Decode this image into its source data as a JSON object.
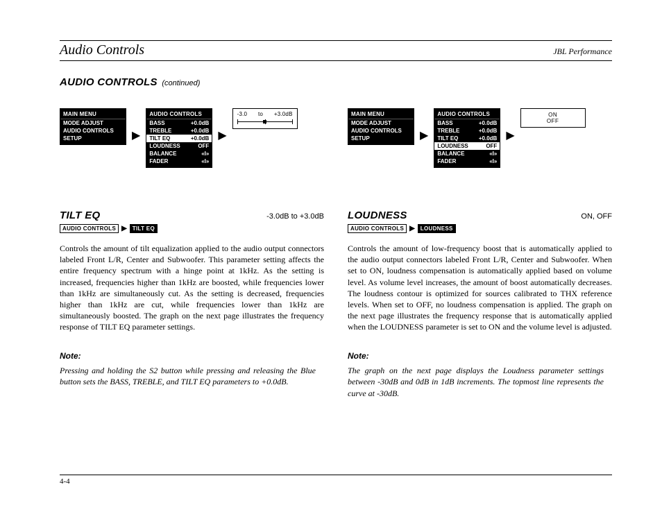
{
  "header": {
    "left": "Audio Controls",
    "right": "JBL Performance"
  },
  "section": {
    "title": "AUDIO CONTROLS",
    "cont": "(continued)"
  },
  "menuA": {
    "title": "MAIN MENU",
    "rows": [
      {
        "l": "MODE ADJUST",
        "r": ""
      },
      {
        "l": "AUDIO CONTROLS",
        "r": ""
      },
      {
        "l": "SETUP",
        "r": ""
      }
    ]
  },
  "menuB": {
    "title": "AUDIO CONTROLS",
    "rows": [
      {
        "l": "BASS",
        "r": "+0.0dB"
      },
      {
        "l": "TREBLE",
        "r": "+0.0dB"
      },
      {
        "l": "TILT EQ",
        "r": "+0.0dB",
        "sel": true
      },
      {
        "l": "LOUDNESS",
        "r": "OFF"
      },
      {
        "l": "BALANCE",
        "r": "«I»"
      },
      {
        "l": "FADER",
        "r": "«I»"
      }
    ]
  },
  "slider": {
    "min": "-3.0",
    "mid": "to",
    "max": "+3.0dB"
  },
  "menuC": {
    "title": "MAIN MENU",
    "rows": [
      {
        "l": "MODE ADJUST",
        "r": ""
      },
      {
        "l": "AUDIO CONTROLS",
        "r": ""
      },
      {
        "l": "SETUP",
        "r": ""
      }
    ]
  },
  "menuD": {
    "title": "AUDIO CONTROLS",
    "rows": [
      {
        "l": "BASS",
        "r": "+0.0dB"
      },
      {
        "l": "TREBLE",
        "r": "+0.0dB"
      },
      {
        "l": "TILT EQ",
        "r": "+0.0dB"
      },
      {
        "l": "LOUDNESS",
        "r": "OFF",
        "sel": true
      },
      {
        "l": "BALANCE",
        "r": "«I»"
      },
      {
        "l": "FADER",
        "r": "«I»"
      }
    ]
  },
  "options": {
    "on": "ON",
    "off": "OFF"
  },
  "left": {
    "title": "TILT EQ",
    "range": "-3.0dB to +3.0dB",
    "crumb1": "AUDIO CONTROLS",
    "crumb2": "TILT EQ",
    "body": "Controls the amount of tilt equalization applied to the audio output connectors labeled Front L/R, Center and Subwoofer. This parameter setting affects the entire frequency spectrum with a hinge point at 1kHz. As the setting is increased, frequencies higher than 1kHz are boosted, while frequencies lower than 1kHz are simultaneously cut. As the setting is decreased, frequencies higher than 1kHz are cut, while frequencies lower than 1kHz are simultaneously boosted. The graph on the next page illustrates the frequency response of TILT EQ parameter settings.",
    "noteH": "Note:",
    "noteBody": "Pressing and holding the S2 button while pressing and releasing the Blue button sets the BASS, TREBLE, and TILT EQ parameters to +0.0dB."
  },
  "right": {
    "title": "LOUDNESS",
    "range": "ON, OFF",
    "crumb1": "AUDIO CONTROLS",
    "crumb2": "LOUDNESS",
    "body": "Controls the amount of low-frequency boost that is automatically applied to the  audio output connectors labeled Front L/R, Center and Subwoofer. When set to ON, loudness compensation is automatically applied based on volume level. As volume level increases, the amount of boost automatically decreases. The loudness contour is optimized for sources calibrated to THX reference levels. When set to OFF, no loudness compensation is applied. The graph on the next page illustrates the frequency response that is automatically applied when the LOUDNESS parameter is set to ON and the volume level is adjusted.",
    "noteH": "Note:",
    "noteBody": "The graph on the next page displays the Loudness parameter settings between -30dB and 0dB in 1dB increments. The topmost line represents the curve at -30dB."
  },
  "footer": {
    "page": "4-4"
  }
}
